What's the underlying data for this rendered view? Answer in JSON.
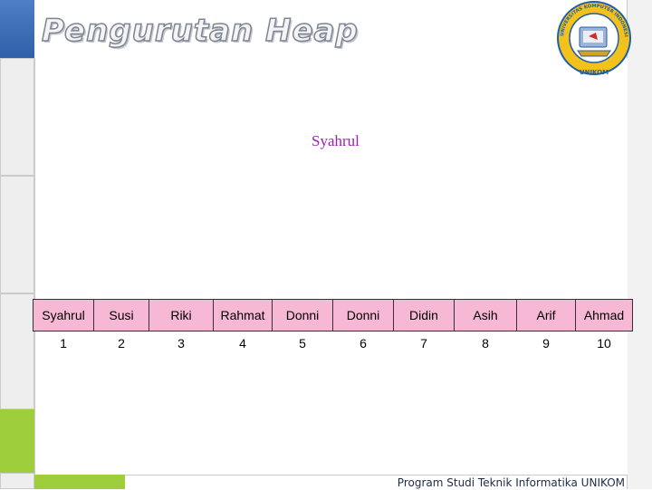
{
  "slide": {
    "title": "Pengurutan Heap",
    "node_label": "Syahrul",
    "footer": "Program Studi Teknik Informatika UNIKOM"
  },
  "logo": {
    "ring_top_text": "UNIVERSITAS KOMPUTER INDONESIA",
    "ring_bottom_text": "UNIKOM",
    "colors": {
      "ring": "#f3c11b",
      "ring_border": "#1f5fa8",
      "text": "#1f5fa8"
    }
  },
  "heap_array": {
    "names": [
      "Syahrul",
      "Susi",
      "Riki",
      "Rahmat",
      "Donni",
      "Donni",
      "Didin",
      "Asih",
      "Arif",
      "Ahmad"
    ],
    "indices": [
      "1",
      "2",
      "3",
      "4",
      "5",
      "6",
      "7",
      "8",
      "9",
      "10"
    ]
  },
  "colors": {
    "cell_fill": "#f7b8d6",
    "node_text": "#9b1fb0",
    "accent_blue": "#2e5fa8",
    "accent_green": "#9fce3d"
  }
}
